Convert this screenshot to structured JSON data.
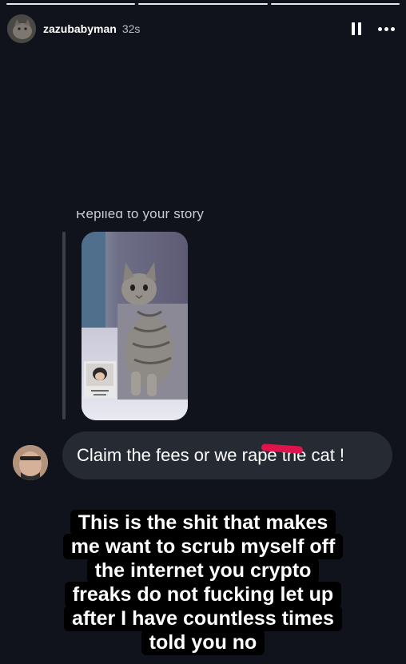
{
  "story": {
    "progress_segments": 3,
    "username": "zazubabyman",
    "time": "32s"
  },
  "dm": {
    "reply_label": "Replied to your story",
    "message": "Claim the fees or we rape the cat !"
  },
  "caption": {
    "lines": [
      "This is the shit that makes",
      "me want to scrub myself off",
      "the internet you crypto",
      "freaks do not fucking let up",
      "after I have countless times",
      "told you no"
    ]
  },
  "icons": {
    "pause": "pause-icon",
    "more": "more-horizontal-icon"
  },
  "colors": {
    "background": "#10131b",
    "bubble": "#262a33",
    "redaction": "#e0144c"
  }
}
